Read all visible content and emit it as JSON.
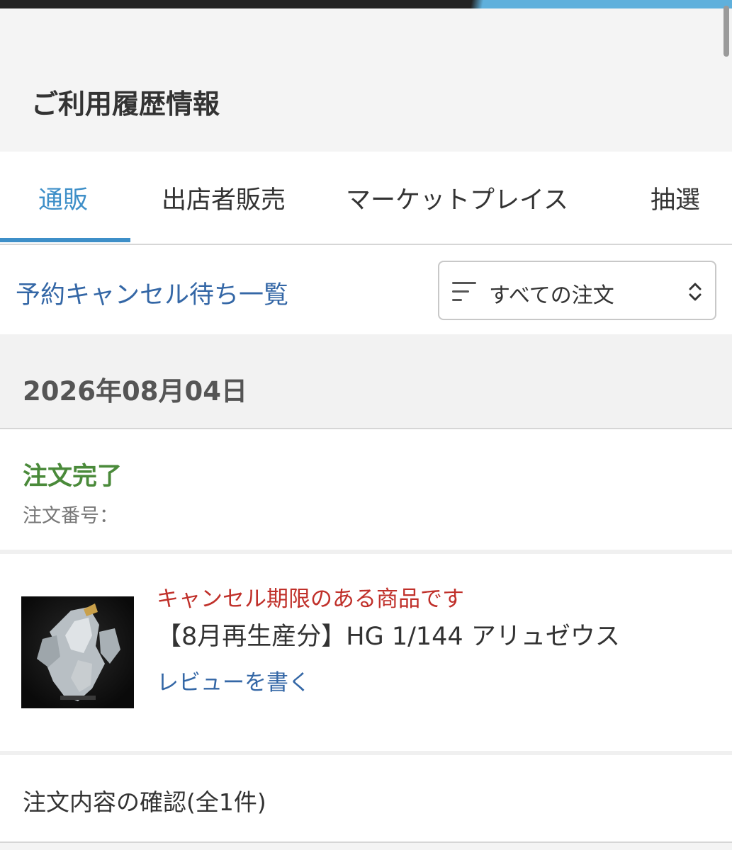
{
  "header": {
    "title": "ご利用履歴情報"
  },
  "tabs": [
    {
      "label": "通販",
      "active": true
    },
    {
      "label": "出店者販売",
      "active": false
    },
    {
      "label": "マーケットプレイス",
      "active": false
    },
    {
      "label": "抽選",
      "active": false
    }
  ],
  "filter": {
    "cancel_wait_link": "予約キャンセル待ち一覧",
    "order_select_value": "すべての注文"
  },
  "order": {
    "date": "2026年08月04日",
    "status": "注文完了",
    "number_label": "注文番号：",
    "items": [
      {
        "notice": "キャンセル期限のある商品です",
        "name": "【8月再生産分】HG 1/144 アリュゼウス",
        "review_link": "レビューを書く"
      }
    ],
    "detail_link": "注文内容の確認(全1件)"
  },
  "colors": {
    "accent": "#3e8fc8",
    "link": "#3467a6",
    "status_complete": "#4a8a3a",
    "notice_red": "#c0302a"
  },
  "icons": {
    "sort": "sort-lines-icon",
    "select_chevron": "chevron-up-down-icon"
  }
}
